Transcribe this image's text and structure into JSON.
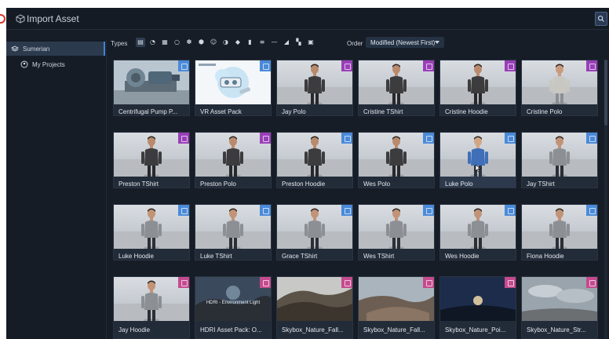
{
  "window": {
    "title": "Import Asset"
  },
  "sidebar": {
    "items": [
      {
        "label": "Sumerian",
        "active": true
      },
      {
        "label": "My Projects",
        "active": false
      }
    ]
  },
  "toolbar": {
    "types_label": "Types",
    "type_icons": [
      "all-assets-icon",
      "material-icon",
      "video-icon",
      "sphere-icon",
      "environment-icon",
      "model-icon",
      "figure-icon",
      "script-icon",
      "audio-icon",
      "document-icon",
      "text-icon",
      "horizontal-line-icon",
      "terrain-icon",
      "entity-icon",
      "image-icon"
    ],
    "order_label": "Order",
    "order_value": "Modified (Newest First)"
  },
  "colors": {
    "tag_blue": "#4a8ad9",
    "tag_purple": "#9a3fb8",
    "tag_pink": "#c54a8e",
    "accent": "#3e87d6"
  },
  "assets": [
    {
      "label": "Centrifugal Pump P...",
      "tag": "blue",
      "thumb": "pump"
    },
    {
      "label": "VR Asset Pack",
      "tag": "blue",
      "thumb": "vr"
    },
    {
      "label": "Jay Polo",
      "tag": "purple",
      "thumb": "host-darkshirt"
    },
    {
      "label": "Cristine TShirt",
      "tag": "purple",
      "thumb": "host-darkshirt"
    },
    {
      "label": "Cristine Hoodie",
      "tag": "purple",
      "thumb": "host-darkshirt"
    },
    {
      "label": "Cristine Polo",
      "tag": "purple",
      "thumb": "host-lightshirt"
    },
    {
      "label": "Preston TShirt",
      "tag": "purple",
      "thumb": "host-darkshirt"
    },
    {
      "label": "Preston Polo",
      "tag": "purple",
      "thumb": "host-darkshirt"
    },
    {
      "label": "Preston Hoodie",
      "tag": "blue",
      "thumb": "host-darkshirt"
    },
    {
      "label": "Wes Polo",
      "tag": "blue",
      "thumb": "host-darkshirt"
    },
    {
      "label": "Luke Polo",
      "tag": "blue",
      "thumb": "host-blueshirt"
    },
    {
      "label": "Jay TShirt",
      "tag": "blue",
      "thumb": "host-grayshirt"
    },
    {
      "label": "Luke Hoodie",
      "tag": "blue",
      "thumb": "host-grayshirt"
    },
    {
      "label": "Luke TShirt",
      "tag": "blue",
      "thumb": "host-grayshirt"
    },
    {
      "label": "Grace TShirt",
      "tag": "blue",
      "thumb": "host-grayshirt"
    },
    {
      "label": "Wes TShirt",
      "tag": "blue",
      "thumb": "host-grayshirt"
    },
    {
      "label": "Wes Hoodie",
      "tag": "blue",
      "thumb": "host-grayshirt"
    },
    {
      "label": "Fiona Hoodie",
      "tag": "blue",
      "thumb": "host-grayshirt"
    },
    {
      "label": "Jay Hoodie",
      "tag": "pink",
      "thumb": "host-grayshirt"
    },
    {
      "label": "HDRI Asset Pack: O...",
      "tag": "pink",
      "thumb": "hdri",
      "caption": "HDRI - Environment Light"
    },
    {
      "label": "Skybox_Nature_Fall...",
      "tag": "pink",
      "thumb": "sky-fall"
    },
    {
      "label": "Skybox_Nature_Fall...",
      "tag": "pink",
      "thumb": "sky-fall2"
    },
    {
      "label": "Skybox_Nature_Poi...",
      "tag": "pink",
      "thumb": "sky-night"
    },
    {
      "label": "Skybox_Nature_Str...",
      "tag": "pink",
      "thumb": "sky-cloud"
    }
  ]
}
